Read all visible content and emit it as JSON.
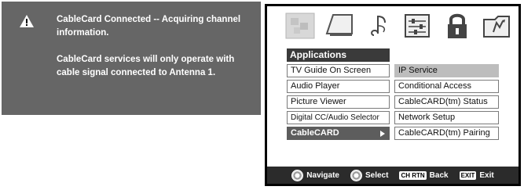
{
  "notice": {
    "icon": "warning-icon",
    "line1": "CableCard Connected -- Acquiring channel information.",
    "line2": "CableCard services will only operate with cable signal connected to Antenna 1."
  },
  "menu": {
    "icons": [
      "picture-icon",
      "sound-icon",
      "music-icon",
      "setup-icon",
      "lock-icon",
      "applications-icon"
    ],
    "title": "Applications",
    "left_items": [
      "TV Guide On Screen",
      "Audio Player",
      "Picture Viewer",
      "Digital CC/Audio Selector",
      "CableCARD"
    ],
    "right_items": [
      "IP Service",
      "Conditional Access",
      "CableCARD(tm) Status",
      "Network Setup",
      "CableCARD(tm) Pairing"
    ]
  },
  "footer": {
    "navigate": "Navigate",
    "select": "Select",
    "back_key": "CH RTN",
    "back": "Back",
    "exit_key": "EXIT",
    "exit": "Exit"
  }
}
